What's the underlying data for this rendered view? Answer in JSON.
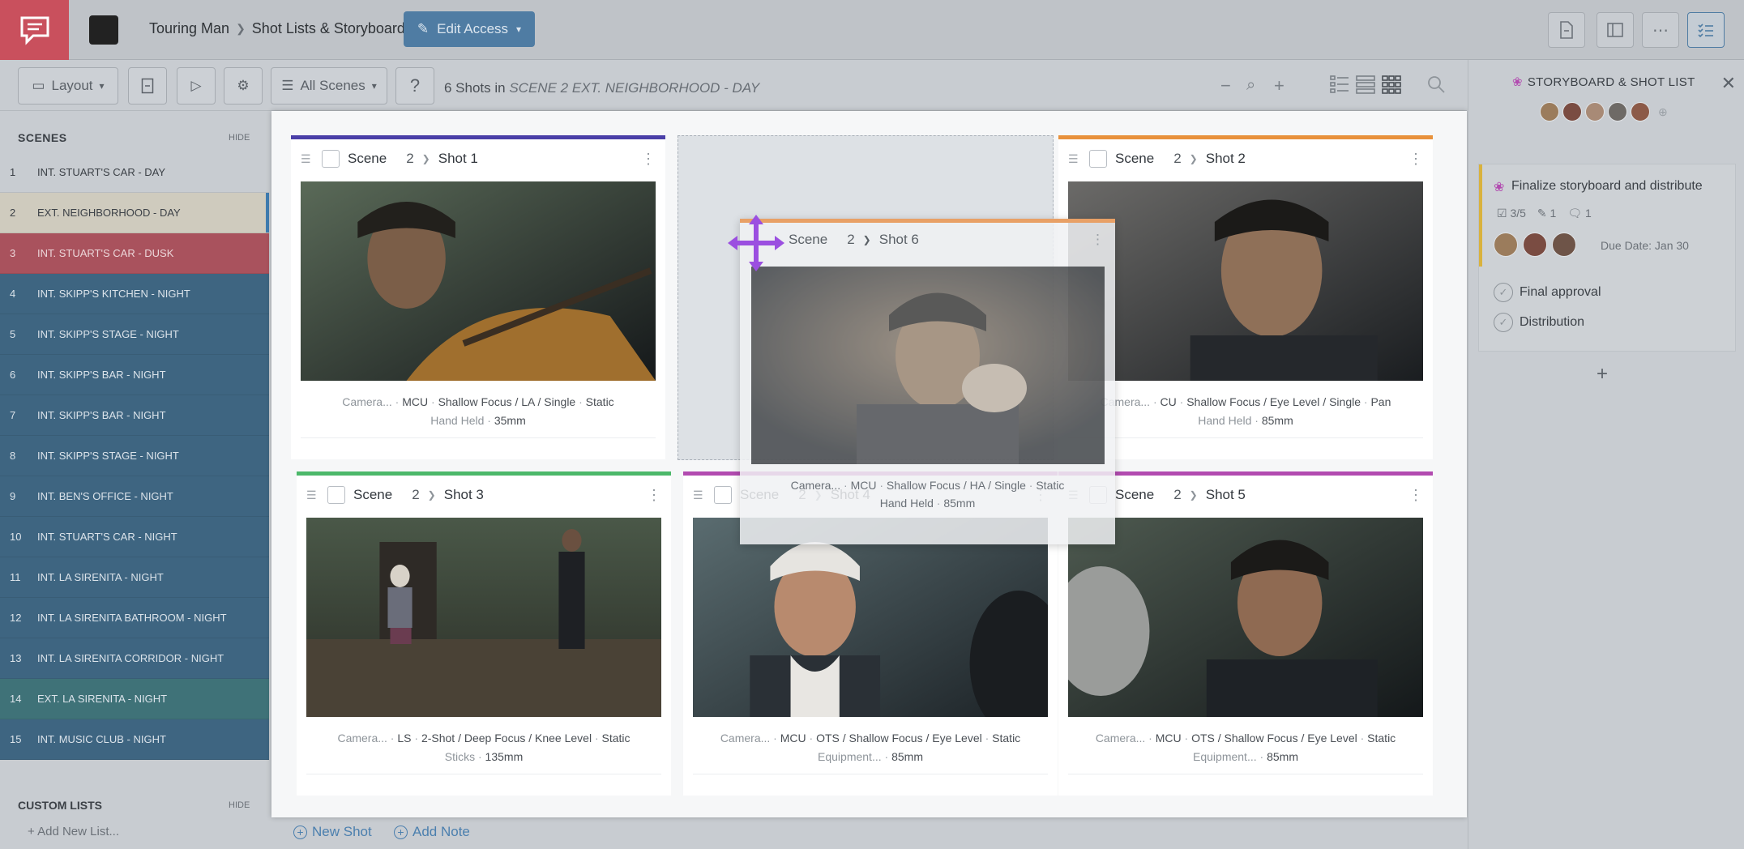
{
  "app": {
    "project": "Touring Man",
    "section": "Shot Lists & Storyboards",
    "edit_access": "Edit Access",
    "org_logo": "Organization"
  },
  "toolbar": {
    "layout": "Layout",
    "all_scenes": "All Scenes",
    "help": "?",
    "shots_count": "6 Shots in",
    "scene_name": "SCENE 2 EXT. NEIGHBORHOOD - DAY"
  },
  "sidebar": {
    "scenes_header": "SCENES",
    "hide": "HIDE",
    "scenes": [
      {
        "num": "1",
        "name": "INT. STUART'S CAR - DAY",
        "type": "int-day"
      },
      {
        "num": "2",
        "name": "EXT. NEIGHBORHOOD - DAY",
        "type": "ext-day"
      },
      {
        "num": "3",
        "name": "INT. STUART'S CAR - DUSK",
        "type": "int-dusk"
      },
      {
        "num": "4",
        "name": "INT. SKIPP'S KITCHEN - NIGHT",
        "type": "int-night"
      },
      {
        "num": "5",
        "name": "INT. SKIPP'S STAGE - NIGHT",
        "type": "int-night"
      },
      {
        "num": "6",
        "name": "INT. SKIPP'S BAR - NIGHT",
        "type": "int-night"
      },
      {
        "num": "7",
        "name": "INT. SKIPP'S BAR - NIGHT",
        "type": "int-night"
      },
      {
        "num": "8",
        "name": "INT. SKIPP'S STAGE - NIGHT",
        "type": "int-night"
      },
      {
        "num": "9",
        "name": "INT. BEN'S OFFICE - NIGHT",
        "type": "int-night"
      },
      {
        "num": "10",
        "name": "INT. STUART'S CAR - NIGHT",
        "type": "int-night"
      },
      {
        "num": "11",
        "name": "INT. LA SIRENITA - NIGHT",
        "type": "int-night"
      },
      {
        "num": "12",
        "name": "INT. LA SIRENITA BATHROOM - NIGHT",
        "type": "int-night"
      },
      {
        "num": "13",
        "name": "INT. LA SIRENITA CORRIDOR - NIGHT",
        "type": "int-night"
      },
      {
        "num": "14",
        "name": "EXT. LA SIRENITA - NIGHT",
        "type": "ext-night"
      },
      {
        "num": "15",
        "name": "INT. MUSIC CLUB - NIGHT",
        "type": "int-night"
      }
    ],
    "custom_lists": "CUSTOM LISTS",
    "custom_hide": "HIDE",
    "add_list": "Add New List..."
  },
  "shots": [
    {
      "id": "shot1",
      "scene_label": "Scene",
      "scene_num": "2",
      "shot": "Shot 1",
      "color": "#4a3fa8",
      "line1": [
        "Camera...",
        "MCU",
        "Shallow Focus / LA / Single",
        "Static"
      ],
      "line2": [
        "Hand Held",
        "35mm"
      ]
    },
    {
      "id": "shot2",
      "scene_label": "Scene",
      "scene_num": "2",
      "shot": "Shot 2",
      "color": "#e8913c",
      "line1": [
        "Camera...",
        "CU",
        "Shallow Focus / Eye Level / Single",
        "Pan"
      ],
      "line2": [
        "Hand Held",
        "85mm"
      ]
    },
    {
      "id": "shot3",
      "scene_label": "Scene",
      "scene_num": "2",
      "shot": "Shot 3",
      "color": "#4cb86a",
      "line1": [
        "Camera...",
        "LS",
        "2-Shot / Deep Focus / Knee Level",
        "Static"
      ],
      "line2": [
        "Sticks",
        "135mm"
      ]
    },
    {
      "id": "shot4",
      "scene_label": "Scene",
      "scene_num": "2",
      "shot": "Shot 4",
      "color": "#b24bb0",
      "line1": [
        "Camera...",
        "MCU",
        "OTS / Shallow Focus / Eye Level",
        "Static"
      ],
      "line2": [
        "Equipment...",
        "85mm"
      ]
    },
    {
      "id": "shot5",
      "scene_label": "Scene",
      "scene_num": "2",
      "shot": "Shot 5",
      "color": "#b24bb0",
      "line1": [
        "Camera...",
        "MCU",
        "OTS / Shallow Focus / Eye Level",
        "Static"
      ],
      "line2": [
        "Equipment...",
        "85mm"
      ]
    }
  ],
  "dragging": {
    "scene_label": "Scene",
    "scene_num": "2",
    "shot": "Shot 6",
    "line1": [
      "Camera...",
      "MCU",
      "Shallow Focus / HA / Single",
      "Static"
    ],
    "line2": [
      "Hand Held",
      "85mm"
    ]
  },
  "footer": {
    "new_shot": "New Shot",
    "new_note": "Add Note"
  },
  "right_panel": {
    "title": "STORYBOARD & SHOT LIST",
    "task_title": "Finalize storyboard and distribute",
    "checklist": "3/5",
    "attachments": "1",
    "comments": "1",
    "due_date": "Due Date: Jan 30",
    "subtasks": [
      "Final approval",
      "Distribution"
    ]
  },
  "colors": {
    "accent": "#4f7ca3",
    "logo": "#c9505d",
    "drag_icon": "#9b4fe0"
  }
}
